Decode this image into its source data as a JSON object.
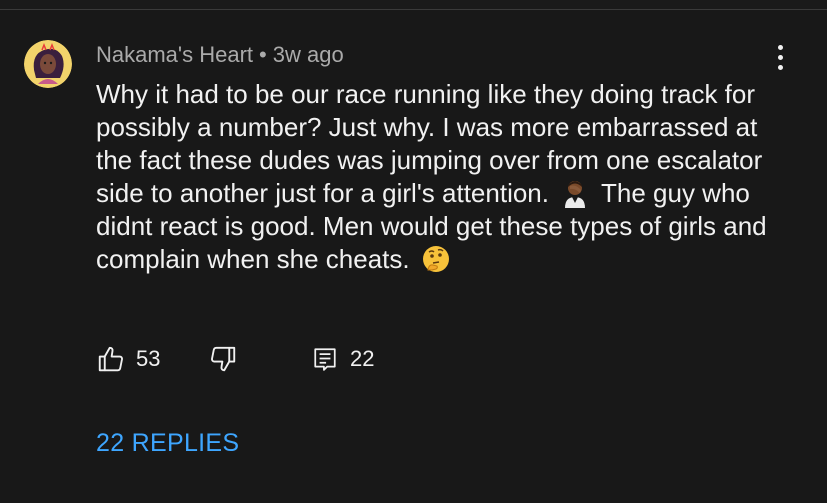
{
  "comment": {
    "author": "Nakama's Heart",
    "separator": "•",
    "timestamp": "3w ago",
    "text": {
      "part1": "Why it had to be our race running like they doing track for possibly a number? Just why. I was more embarrassed at the fact these dudes was jumping over from one escalator side to another just for a girl's attention.",
      "emoji1": "man-facepalming-emoji",
      "part2": "The guy who didnt react is good. Men would get these types of girls and complain when she cheats.",
      "emoji2": "thinking-face-emoji"
    },
    "likes": "53",
    "replies_count": "22",
    "replies_link": "22 REPLIES"
  },
  "icons": {
    "avatar": "avatar",
    "more": "more-vertical-icon",
    "like": "thumbs-up-icon",
    "dislike": "thumbs-down-icon",
    "reply": "comment-icon"
  },
  "colors": {
    "background": "#181818",
    "text": "#f1f1f1",
    "secondary_text": "#aaaaaa",
    "link": "#3ea6ff",
    "avatar_bg": "#f2d36b"
  }
}
